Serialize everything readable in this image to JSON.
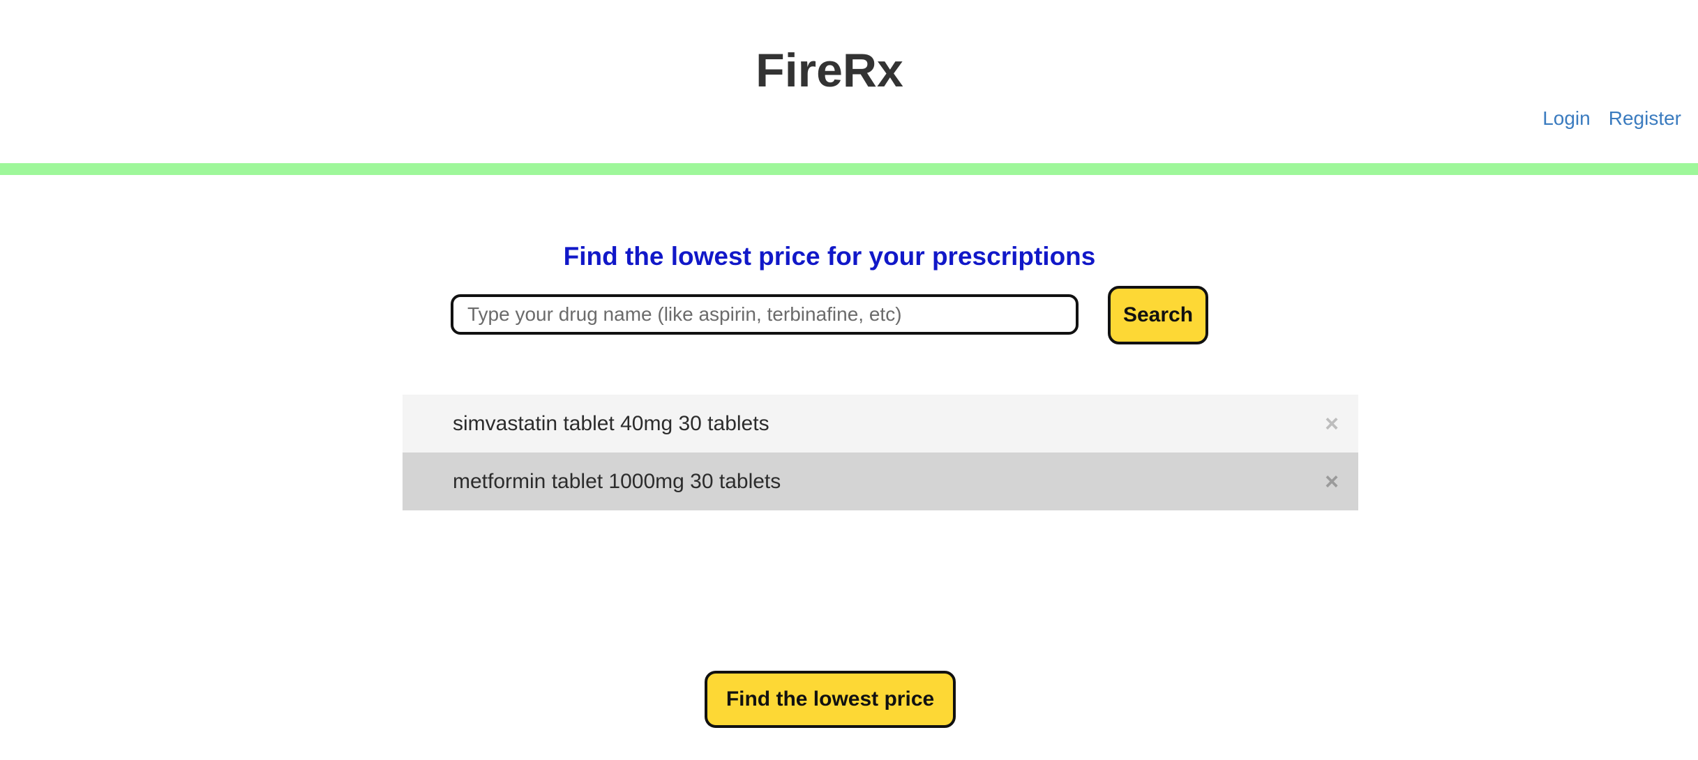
{
  "header": {
    "brand": "FireRx",
    "nav": {
      "login": "Login",
      "register": "Register"
    }
  },
  "colors": {
    "accent_bar": "#9ef79a",
    "headline": "#1118c8",
    "button": "#fdd835",
    "link": "#3a7bbf",
    "row_light": "#f4f4f4",
    "row_dark": "#d4d4d4"
  },
  "main": {
    "headline": "Find the lowest price for your prescriptions",
    "search": {
      "value": "",
      "placeholder": "Type your drug name (like aspirin, terbinafine, etc)",
      "button_label": "Search"
    },
    "prescriptions": [
      {
        "label": "simvastatin tablet 40mg 30 tablets",
        "remove_icon": "close-icon",
        "remove_glyph": "×"
      },
      {
        "label": "metformin tablet 1000mg 30 tablets",
        "remove_icon": "close-icon",
        "remove_glyph": "×"
      }
    ],
    "find_button_label": "Find the lowest price"
  }
}
